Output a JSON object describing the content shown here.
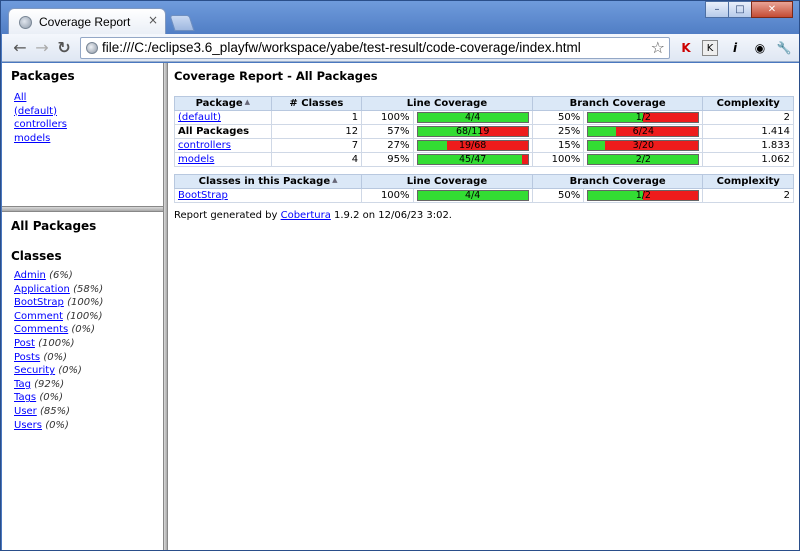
{
  "browser": {
    "tab_title": "Coverage Report",
    "tab_close": "×",
    "url": "file:///C:/eclipse3.6_playfw/workspace/yabe/test-result/code-coverage/index.html"
  },
  "packages_pane": {
    "title": "Packages",
    "items": [
      "All",
      "(default)",
      "controllers",
      "models"
    ]
  },
  "classes_pane": {
    "heading": "All Packages",
    "subheading": "Classes",
    "items": [
      {
        "name": "Admin",
        "pct": "(6%)"
      },
      {
        "name": "Application",
        "pct": "(58%)"
      },
      {
        "name": "BootStrap",
        "pct": "(100%)"
      },
      {
        "name": "Comment",
        "pct": "(100%)"
      },
      {
        "name": "Comments",
        "pct": "(0%)"
      },
      {
        "name": "Post",
        "pct": "(100%)"
      },
      {
        "name": "Posts",
        "pct": "(0%)"
      },
      {
        "name": "Security",
        "pct": "(0%)"
      },
      {
        "name": "Tag",
        "pct": "(92%)"
      },
      {
        "name": "Tags",
        "pct": "(0%)"
      },
      {
        "name": "User",
        "pct": "(85%)"
      },
      {
        "name": "Users",
        "pct": "(0%)"
      }
    ]
  },
  "main": {
    "title": "Coverage Report - All Packages",
    "packages_table": {
      "headers": [
        "Package",
        "# Classes",
        "Line Coverage",
        "Branch Coverage",
        "Complexity"
      ],
      "rows": [
        {
          "name": "(default)",
          "link": true,
          "classes": "1",
          "line_pct": "100%",
          "line_frac": 1.0,
          "line_label": "4/4",
          "branch_pct": "50%",
          "branch_frac": 0.5,
          "branch_label": "1/2",
          "complexity": "2"
        },
        {
          "name": "All Packages",
          "link": false,
          "classes": "12",
          "line_pct": "57%",
          "line_frac": 0.57,
          "line_label": "68/119",
          "branch_pct": "25%",
          "branch_frac": 0.25,
          "branch_label": "6/24",
          "complexity": "1.414"
        },
        {
          "name": "controllers",
          "link": true,
          "classes": "7",
          "line_pct": "27%",
          "line_frac": 0.27,
          "line_label": "19/68",
          "branch_pct": "15%",
          "branch_frac": 0.15,
          "branch_label": "3/20",
          "complexity": "1.833"
        },
        {
          "name": "models",
          "link": true,
          "classes": "4",
          "line_pct": "95%",
          "line_frac": 0.95,
          "line_label": "45/47",
          "branch_pct": "100%",
          "branch_frac": 1.0,
          "branch_label": "2/2",
          "complexity": "1.062"
        }
      ]
    },
    "classes_table": {
      "headers": [
        "Classes in this Package",
        "Line Coverage",
        "Branch Coverage",
        "Complexity"
      ],
      "rows": [
        {
          "name": "BootStrap",
          "line_pct": "100%",
          "line_frac": 1.0,
          "line_label": "4/4",
          "branch_pct": "50%",
          "branch_frac": 0.5,
          "branch_label": "1/2",
          "complexity": "2"
        }
      ]
    },
    "footer": {
      "prefix": "Report generated by ",
      "link": "Cobertura",
      "suffix": " 1.9.2 on 12/06/23 3:02."
    }
  },
  "colors": {
    "covered": "#33dd33",
    "uncovered": "#ee1c1c",
    "header_bg": "#dbe8f7"
  }
}
